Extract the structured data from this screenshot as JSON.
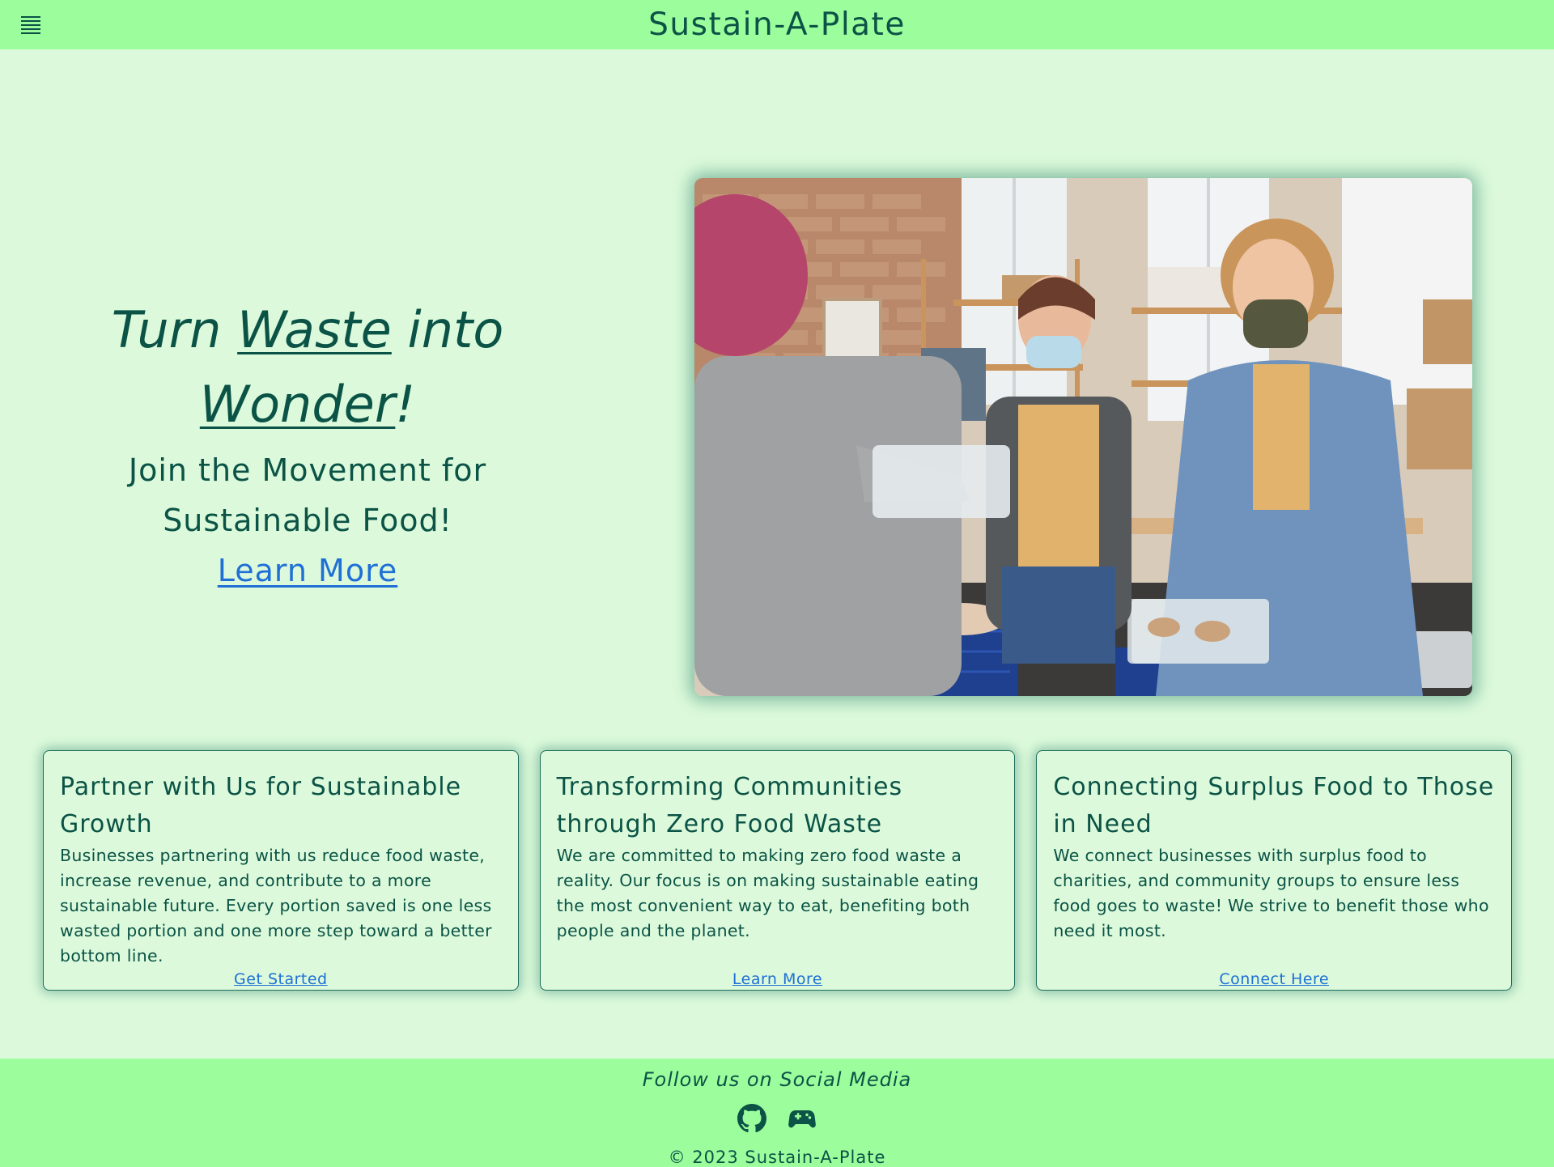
{
  "header": {
    "menu_icon": "menu-icon",
    "site_title": "Sustain-A-Plate"
  },
  "hero": {
    "headline_part1": "Turn ",
    "headline_word1": "Waste",
    "headline_part2": " into ",
    "headline_word2": "Wonder",
    "headline_end": "!",
    "subheading": "Join the Movement for Sustainable Food!",
    "cta_link": "Learn More"
  },
  "cards": [
    {
      "title": "Partner with Us for Sustainable Growth",
      "body": "Businesses partnering with us reduce food waste, increase revenue, and contribute to a more sustainable future. Every portion saved is one less wasted portion and one more step toward a better bottom line.",
      "link": "Get Started"
    },
    {
      "title": "Transforming Communities through Zero Food Waste",
      "body": "We are committed to making zero food waste a reality. Our focus is on making sustainable eating the most convenient way to eat, benefiting both people and the planet.",
      "link": "Learn More"
    },
    {
      "title": "Connecting Surplus Food to Those in Need",
      "body": "We connect businesses with surplus food to charities, and community groups to ensure less food goes to waste! We strive to benefit those who need it most.",
      "link": "Connect Here"
    }
  ],
  "footer": {
    "heading": "Follow us on Social Media",
    "social_icons": [
      "github-icon",
      "discord-icon"
    ],
    "copyright": "© 2023 Sustain-A-Plate"
  },
  "colors": {
    "header_bg": "#9cfd9c",
    "page_bg": "#dcfadb",
    "text": "#0b5346",
    "link": "#1f6fd6"
  }
}
